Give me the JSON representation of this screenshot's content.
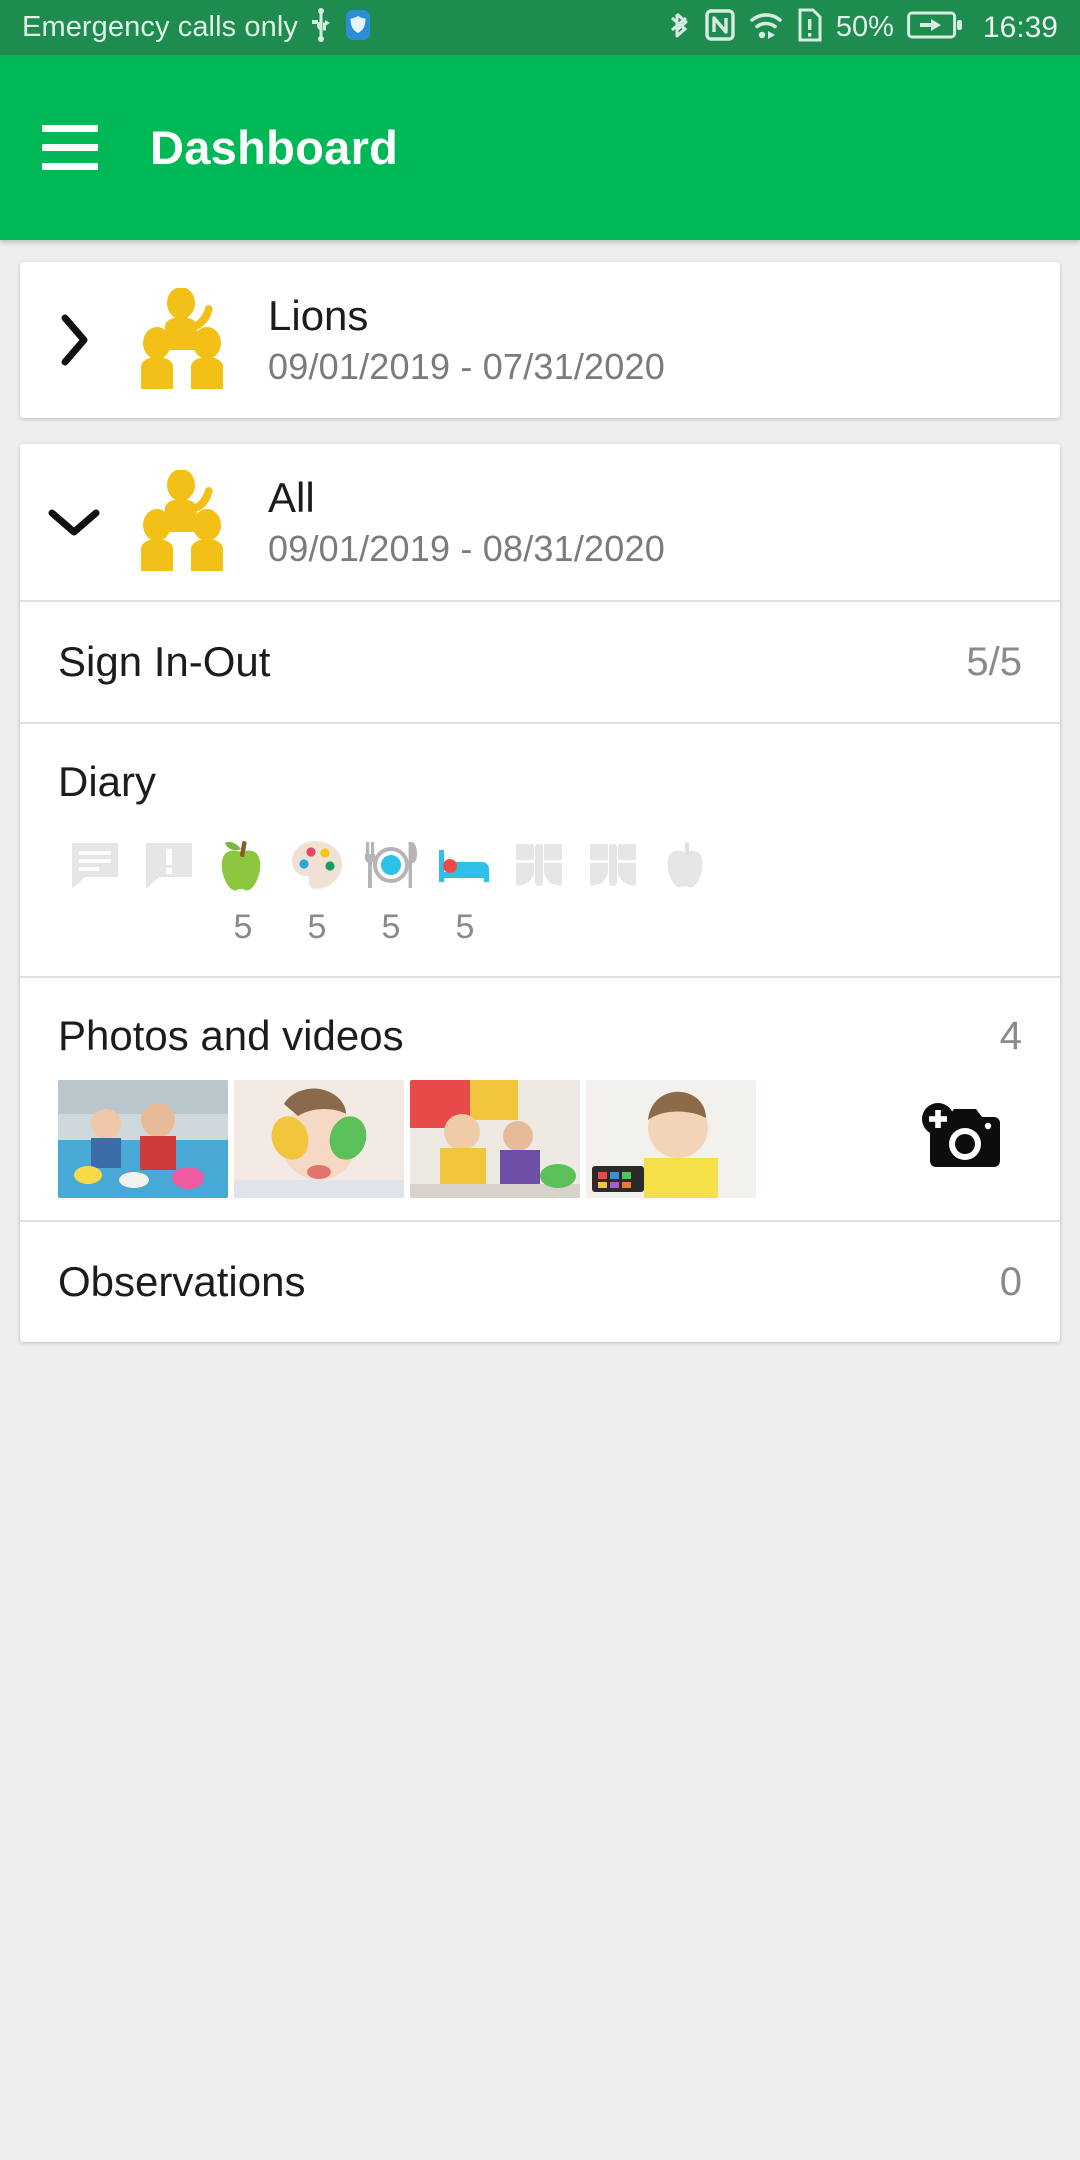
{
  "statusbar": {
    "carrier_text": "Emergency calls only",
    "icons": [
      "usb-icon",
      "shield-icon",
      "bluetooth-icon",
      "nfc-icon",
      "wifi-icon",
      "sim-alert-icon",
      "battery-charging-icon"
    ],
    "battery_percent": "50%",
    "time": "16:39"
  },
  "appbar": {
    "menu_icon": "hamburger-menu-icon",
    "title": "Dashboard",
    "background": "#00b956"
  },
  "groups": [
    {
      "name": "Lions",
      "dates": "09/01/2019 - 07/31/2020",
      "chevron": "chevron-right-icon",
      "expanded": false,
      "icon": "group-people-icon"
    },
    {
      "name": "All",
      "dates": "09/01/2019 - 08/31/2020",
      "chevron": "chevron-down-icon",
      "expanded": true,
      "icon": "group-people-icon"
    }
  ],
  "sections": {
    "sign_in_out": {
      "label": "Sign In-Out",
      "value": "5/5"
    },
    "diary": {
      "label": "Diary",
      "entries": [
        {
          "icon": "message-bubble-icon",
          "count": "",
          "active": false
        },
        {
          "icon": "alert-bubble-icon",
          "count": "",
          "active": false
        },
        {
          "icon": "apple-icon",
          "count": "5",
          "active": true
        },
        {
          "icon": "paint-palette-icon",
          "count": "5",
          "active": true
        },
        {
          "icon": "meal-plate-icon",
          "count": "5",
          "active": true
        },
        {
          "icon": "bed-sleep-icon",
          "count": "5",
          "active": true
        },
        {
          "icon": "nappy-icon",
          "count": "",
          "active": false
        },
        {
          "icon": "nappy-icon",
          "count": "",
          "active": false
        },
        {
          "icon": "apple-bite-icon",
          "count": "",
          "active": false
        }
      ]
    },
    "photos": {
      "label": "Photos and videos",
      "value": "4",
      "add_button_icon": "add-camera-icon",
      "thumbnails": [
        {
          "name": "children-eating-at-table"
        },
        {
          "name": "girl-with-painted-hands"
        },
        {
          "name": "children-playing-toys"
        },
        {
          "name": "boy-painting-watercolors"
        }
      ]
    },
    "observations": {
      "label": "Observations",
      "value": "0"
    }
  },
  "colors": {
    "status_bar": "#1e8c4f",
    "app_bar": "#00b956",
    "group_icon": "#f2c017",
    "page_background": "#eeeeee",
    "muted_text": "#8a8a8a",
    "inactive_icon": "#e6e6e6"
  }
}
